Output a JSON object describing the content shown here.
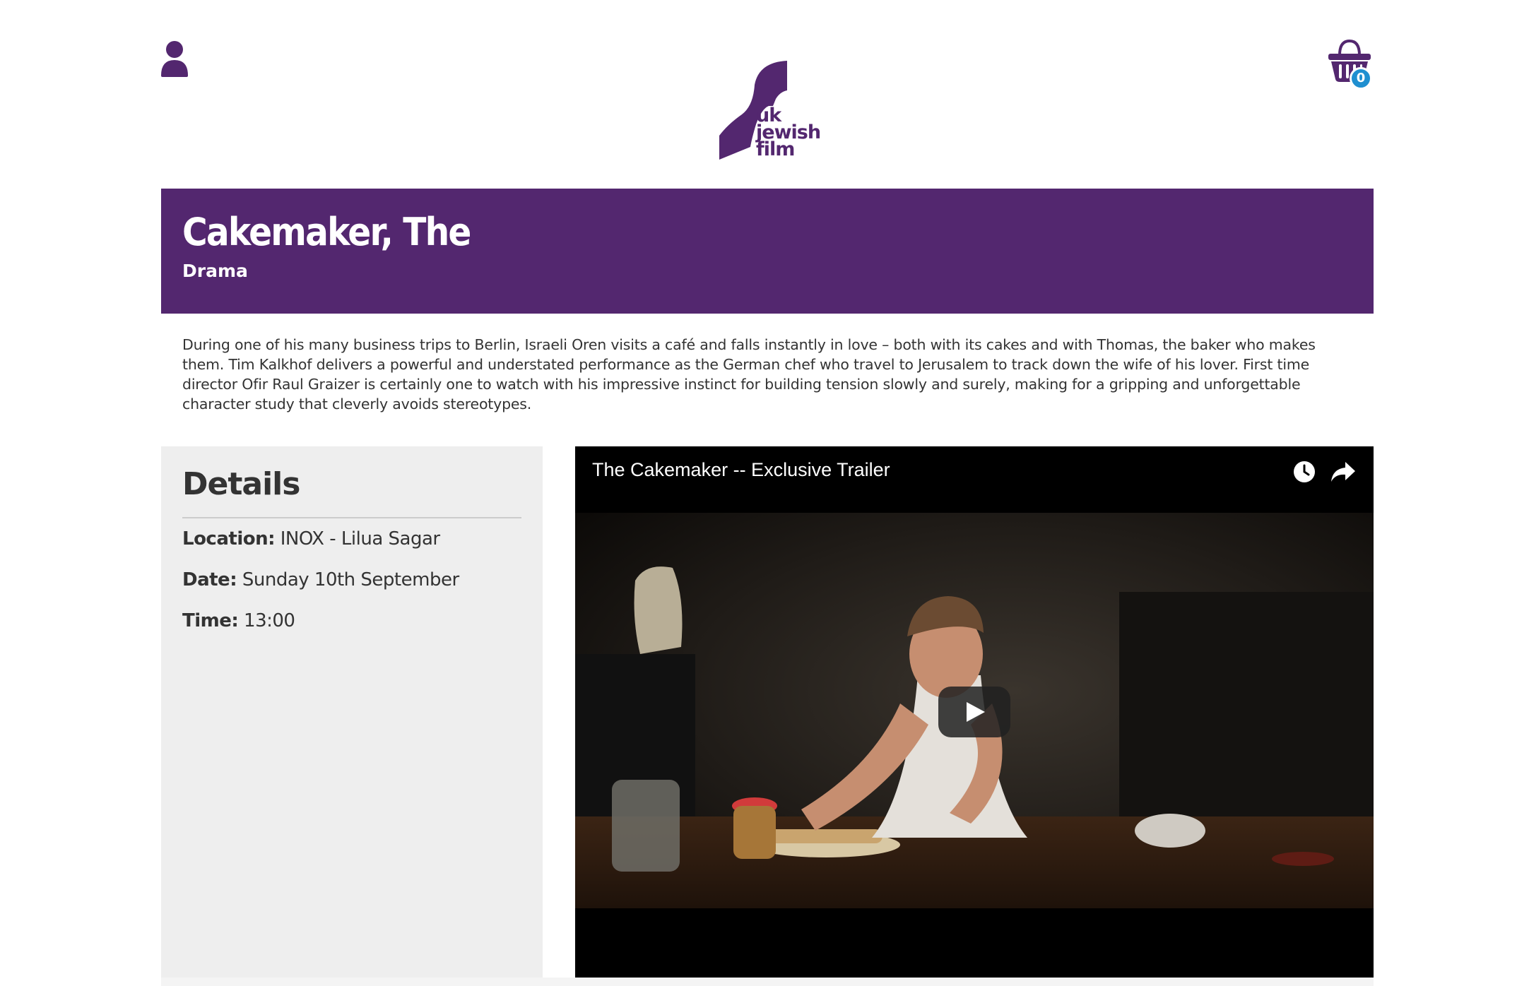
{
  "header": {
    "user_icon": "user-icon",
    "basket_icon": "basket-icon",
    "basket_count": "0",
    "logo": {
      "lines": [
        "uk",
        "jewish",
        "film"
      ]
    }
  },
  "film": {
    "title": "Cakemaker, The",
    "genre": "Drama",
    "description": "During one of his many business trips to Berlin, Israeli Oren visits a café and falls instantly in love – both with its cakes and with Thomas, the baker who makes them. Tim Kalkhof delivers a powerful and understated performance as the German chef who travel to Jerusalem to track down the wife of his lover. First time director Ofir Raul Graizer is certainly one to watch with his impressive instinct for building tension slowly and surely, making for a gripping and unforgettable character study that cleverly avoids stereotypes."
  },
  "details": {
    "heading": "Details",
    "location_label": "Location:",
    "location_value": "INOX - Lilua Sagar",
    "date_label": "Date:",
    "date_value": "Sunday 10th September",
    "time_label": "Time:",
    "time_value": "13:00"
  },
  "video": {
    "title": "The Cakemaker -- Exclusive Trailer",
    "watch_later_icon": "clock-icon",
    "share_icon": "share-icon",
    "play_icon": "play-icon"
  },
  "colors": {
    "brand_purple": "#53276f",
    "badge_blue": "#1f8fd0",
    "details_bg": "#eeeeee"
  }
}
